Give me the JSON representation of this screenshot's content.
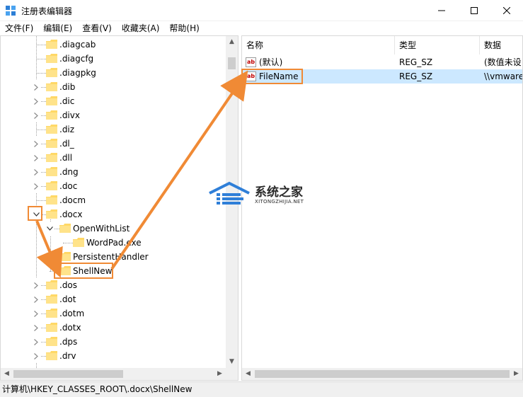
{
  "window": {
    "title": "注册表编辑器",
    "minimize_glyph": "—",
    "maximize_glyph": "☐",
    "close_glyph": "✕"
  },
  "menu": [
    "文件(F)",
    "编辑(E)",
    "查看(V)",
    "收藏夹(A)",
    "帮助(H)"
  ],
  "tree": {
    "items": [
      ".diagcab",
      ".diagcfg",
      ".diagpkg",
      ".dib",
      ".dic",
      ".divx",
      ".diz",
      ".dl_",
      ".dll",
      ".dng",
      ".doc",
      ".docm",
      ".docx",
      "OpenWithList",
      "WordPad.exe",
      "PersistentHandler",
      "ShellNew",
      ".dos",
      ".dot",
      ".dotm",
      ".dotx",
      ".dps",
      ".drv"
    ]
  },
  "list": {
    "headers": {
      "name": "名称",
      "type": "类型",
      "data": "数据"
    },
    "rows": [
      {
        "name": "(默认)",
        "type": "REG_SZ",
        "data": "(数值未设"
      },
      {
        "name": "FileName",
        "type": "REG_SZ",
        "data": "\\\\vmware"
      }
    ],
    "value_icon_text": "ab"
  },
  "status": {
    "path": "计算机\\HKEY_CLASSES_ROOT\\.docx\\ShellNew"
  },
  "watermark": {
    "cn": "系统之家",
    "en": "XITONGZHIJIA.NET"
  },
  "colors": {
    "accent": "#f08a35",
    "selection": "#cce8ff",
    "folder": "#ffd866"
  }
}
